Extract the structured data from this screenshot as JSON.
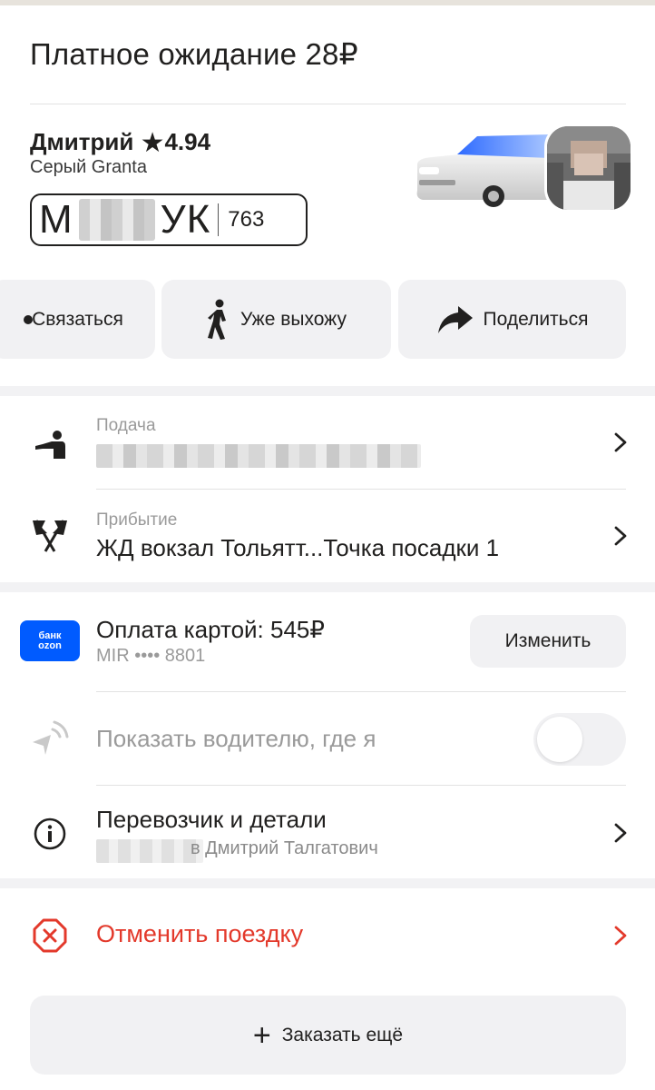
{
  "header": {
    "title": "Платное ожидание 28₽"
  },
  "driver": {
    "name": "Дмитрий",
    "rating": "4.94",
    "car": "Серый Granta",
    "plate_first": "М",
    "plate_letters": "УК",
    "plate_region": "763"
  },
  "actions": [
    {
      "label": "Связаться",
      "icon": "phone-icon"
    },
    {
      "label": "Уже выхожу",
      "icon": "walking-person-icon"
    },
    {
      "label": "Поделиться",
      "icon": "share-arrow-icon"
    }
  ],
  "route": {
    "pickup_label": "Подача",
    "destination_label": "Прибытие",
    "destination_value": "ЖД вокзал Тольятт...Точка посадки 1"
  },
  "payment": {
    "title": "Оплата картой: 545₽",
    "card": "MIR •••• 8801",
    "bank_logo_line1": "банк",
    "bank_logo_line2": "ozon",
    "change_label": "Изменить"
  },
  "show_location": {
    "label": "Показать водителю, где я",
    "enabled": false
  },
  "carrier": {
    "title": "Перевозчик и детали",
    "name_visible": "в Дмитрий Талгатович"
  },
  "cancel": {
    "label": "Отменить поездку"
  },
  "order_more": {
    "label": "Заказать ещё"
  },
  "colors": {
    "accent_red": "#e3392b",
    "bank_blue": "#005bff",
    "button_bg": "#f1f1f3",
    "text_primary": "#21201f",
    "text_secondary": "#9a9a9a"
  }
}
